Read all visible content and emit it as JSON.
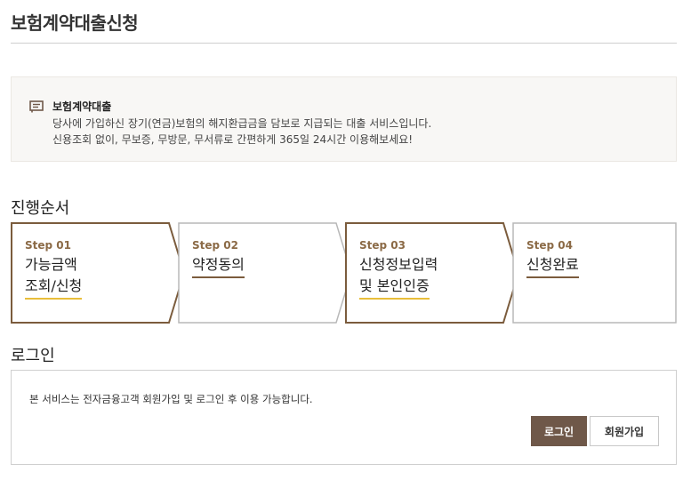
{
  "page": {
    "title": "보험계약대출신청"
  },
  "info": {
    "title": "보험계약대출",
    "lines": [
      "당사에 가입하신 장기(연금)보험의 해지환급금을 담보로 지급되는 대출 서비스입니다.",
      "신용조회 없이, 무보증, 무방문, 무서류로 간편하게 365일 24시간 이용해보세요!"
    ],
    "icon": "document-note-icon"
  },
  "process": {
    "title": "진행순서",
    "steps": [
      {
        "num": "Step 01",
        "line1": "가능금액",
        "line2": "조회/신청",
        "state": "active"
      },
      {
        "num": "Step 02",
        "line1": "약정동의",
        "line2": "",
        "state": "inactive"
      },
      {
        "num": "Step 03",
        "line1": "신청정보입력",
        "line2": "및 본인인증",
        "state": "active"
      },
      {
        "num": "Step 04",
        "line1": "신청완료",
        "line2": "",
        "state": "inactive"
      }
    ]
  },
  "login": {
    "title": "로그인",
    "description": "본 서비스는 전자금융고객 회원가입 및 로그인 후 이용 가능합니다.",
    "login_button": "로그인",
    "join_button": "회원가입"
  },
  "colors": {
    "accent_brown": "#7b5c3d",
    "underline_gold": "#e8be3a",
    "button_brown": "#6f5849"
  }
}
